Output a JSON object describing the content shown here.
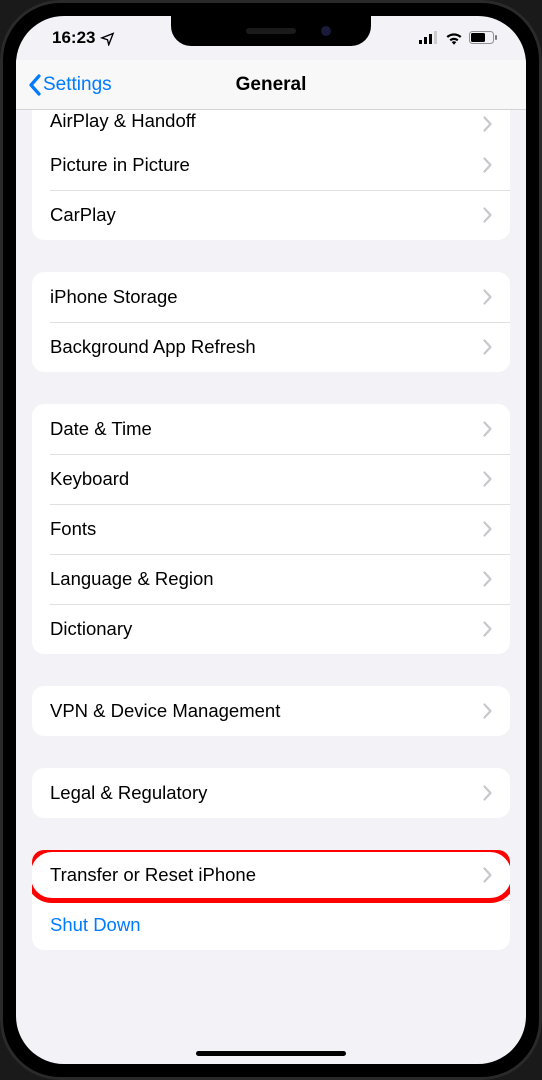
{
  "status": {
    "time": "16:23",
    "location_icon": "location-arrow",
    "cellular": "signal-3",
    "wifi": "wifi",
    "battery": "battery-medium"
  },
  "nav": {
    "back_label": "Settings",
    "title": "General"
  },
  "sections": [
    {
      "id": "group-airplay",
      "rows": [
        {
          "label": "AirPlay & Handoff",
          "truncated": true,
          "chevron": true
        },
        {
          "label": "Picture in Picture",
          "chevron": true
        },
        {
          "label": "CarPlay",
          "chevron": true
        }
      ]
    },
    {
      "id": "group-storage",
      "rows": [
        {
          "label": "iPhone Storage",
          "chevron": true
        },
        {
          "label": "Background App Refresh",
          "chevron": true
        }
      ]
    },
    {
      "id": "group-locale",
      "rows": [
        {
          "label": "Date & Time",
          "chevron": true
        },
        {
          "label": "Keyboard",
          "chevron": true
        },
        {
          "label": "Fonts",
          "chevron": true
        },
        {
          "label": "Language & Region",
          "chevron": true
        },
        {
          "label": "Dictionary",
          "chevron": true
        }
      ]
    },
    {
      "id": "group-vpn",
      "rows": [
        {
          "label": "VPN & Device Management",
          "chevron": true
        }
      ]
    },
    {
      "id": "group-legal",
      "rows": [
        {
          "label": "Legal & Regulatory",
          "chevron": true
        }
      ]
    },
    {
      "id": "group-reset",
      "rows": [
        {
          "label": "Transfer or Reset iPhone",
          "chevron": true,
          "highlighted": true
        },
        {
          "label": "Shut Down",
          "chevron": false,
          "blue": true
        }
      ]
    }
  ]
}
